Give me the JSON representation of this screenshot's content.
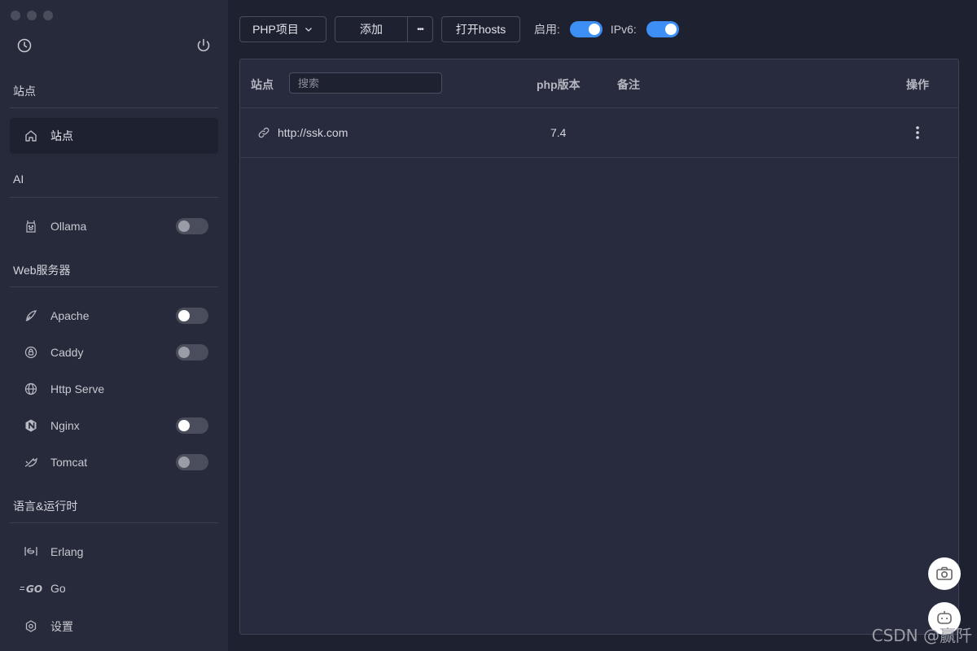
{
  "sidebar": {
    "sections": [
      {
        "title": "站点"
      },
      {
        "title": "AI"
      },
      {
        "title": "Web服务器"
      },
      {
        "title": "语言&运行时"
      }
    ],
    "items": {
      "site": {
        "label": "站点",
        "icon": "home-icon"
      },
      "ollama": {
        "label": "Ollama",
        "icon": "llama-icon",
        "enabled": false
      },
      "apache": {
        "label": "Apache",
        "icon": "feather-icon",
        "enabled": false
      },
      "caddy": {
        "label": "Caddy",
        "icon": "caddy-icon",
        "enabled": false
      },
      "http_serve": {
        "label": "Http Serve",
        "icon": "globe-icon"
      },
      "nginx": {
        "label": "Nginx",
        "icon": "nginx-icon",
        "enabled": false
      },
      "tomcat": {
        "label": "Tomcat",
        "icon": "tomcat-icon",
        "enabled": false
      },
      "erlang": {
        "label": "Erlang",
        "icon": "erlang-icon"
      },
      "go": {
        "label": "Go",
        "icon": "go-icon"
      },
      "settings": {
        "label": "设置",
        "icon": "gear-icon"
      }
    }
  },
  "toolbar": {
    "project_select": "PHP项目",
    "add_label": "添加",
    "more_label": "•••",
    "hosts_label": "打开hosts",
    "enable_label": "启用:",
    "enable_on": true,
    "ipv6_label": "IPv6:",
    "ipv6_on": true
  },
  "table": {
    "columns": {
      "site": "站点",
      "php": "php版本",
      "note": "备注",
      "ops": "操作"
    },
    "search_placeholder": "搜索",
    "rows": [
      {
        "url": "http://ssk.com",
        "php": "7.4",
        "note": ""
      }
    ]
  },
  "watermark": "CSDN @赢阡",
  "colors": {
    "accent": "#3d8ff5",
    "sidebar_bg": "#262a3a",
    "main_bg": "#1e2130",
    "panel_bg": "#282b3d"
  }
}
